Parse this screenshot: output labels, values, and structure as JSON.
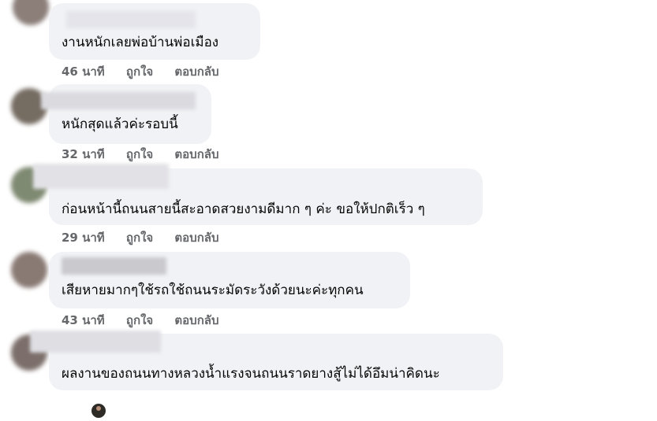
{
  "comments": [
    {
      "text": "งานหนักเลยพ่อบ้านพ่อเมือง",
      "time": "46 นาที",
      "like_label": "ถูกใจ",
      "reply_label": "ตอบกลับ"
    },
    {
      "text": "หนักสุดแล้วค่ะรอบนี้",
      "time": "32 นาที",
      "like_label": "ถูกใจ",
      "reply_label": "ตอบกลับ"
    },
    {
      "text": "ก่อนหน้านี้ถนนสายนี้สะอาดสวยงามดีมาก ๆ ค่ะ ขอให้ปกติเร็ว ๆ",
      "time": "29 นาที",
      "like_label": "ถูกใจ",
      "reply_label": "ตอบกลับ"
    },
    {
      "text": "เสียหายมากๆใช้รถใช้ถนนระมัดระวังด้วยนะค่ะทุกคน",
      "time": "43 นาที",
      "like_label": "ถูกใจ",
      "reply_label": "ตอบกลับ"
    },
    {
      "text": "ผลงานของถนนทางหลวงน้ำแรงจนถนนราดยางสู้ไม่ได้อึมน่าคิดนะ"
    }
  ],
  "colors": {
    "bubble": "#f0f2f5",
    "text": "#050505",
    "action_text": "#65676b"
  }
}
